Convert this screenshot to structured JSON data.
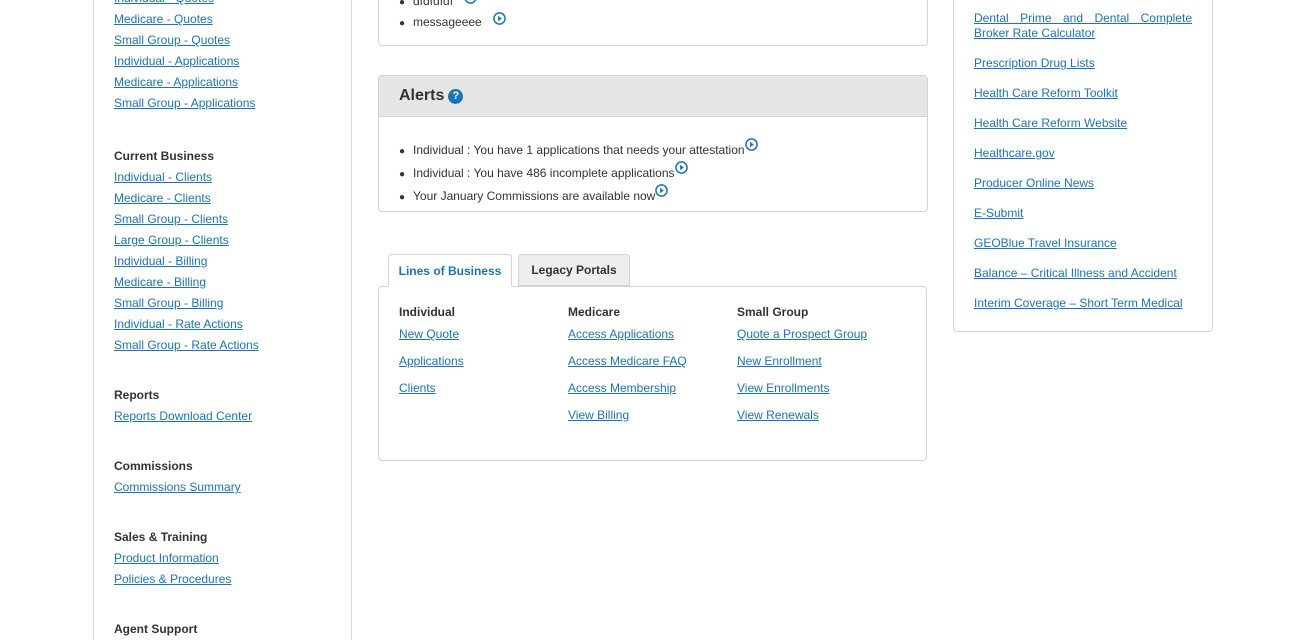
{
  "sidebar": {
    "quotes_links": [
      "Individual - Quotes",
      "Medicare - Quotes",
      "Small Group - Quotes",
      "Individual - Applications",
      "Medicare - Applications",
      "Small Group - Applications"
    ],
    "current_business": {
      "heading": "Current Business",
      "links": [
        "Individual - Clients",
        "Medicare - Clients",
        "Small Group - Clients",
        "Large Group - Clients",
        "Individual - Billing",
        "Medicare - Billing",
        "Small Group - Billing",
        "Individual - Rate Actions",
        "Small Group - Rate Actions"
      ]
    },
    "reports": {
      "heading": "Reports",
      "links": [
        "Reports Download Center"
      ]
    },
    "commissions": {
      "heading": "Commissions",
      "links": [
        "Commissions Summary"
      ]
    },
    "sales_training": {
      "heading": "Sales & Training",
      "links": [
        "Product Information",
        "Policies & Procedures"
      ]
    },
    "next_heading_partial": "Agent Support"
  },
  "messages": {
    "items": [
      "dfdfdfdf",
      "messageeee"
    ]
  },
  "alerts": {
    "title": "Alerts",
    "help_glyph": "?",
    "items": [
      "Individual : You have 1 applications that needs your attestation",
      "Individual : You have 486 incomplete applications",
      "Your January Commissions are available now"
    ]
  },
  "tabs": {
    "lines_of_business": "Lines of Business",
    "legacy_portals": "Legacy Portals",
    "active": "Lines of Business"
  },
  "lines_of_business": {
    "individual": {
      "heading": "Individual",
      "links": [
        "New Quote",
        "Applications",
        "Clients"
      ]
    },
    "medicare": {
      "heading": "Medicare",
      "links": [
        "Access Applications",
        "Access Medicare FAQ",
        "Access Membership",
        "View Billing"
      ]
    },
    "small_group": {
      "heading": "Small Group",
      "links": [
        "Quote a Prospect Group",
        "New Enrollment",
        "View Enrollments",
        "View Renewals"
      ]
    }
  },
  "resources": {
    "links": [
      "Dental Prime and Dental Complete Broker Rate Calculator",
      "Prescription Drug Lists",
      "Health Care Reform Toolkit",
      "Health Care Reform Website",
      "Healthcare.gov",
      "Producer Online News",
      "E-Submit",
      "GEOBlue Travel Insurance",
      "Balance – Critical Illness and Accident",
      "Interim Coverage – Short Term Medical"
    ]
  },
  "colors": {
    "link": "#1a75b5",
    "text": "#333333",
    "border": "#d4d4d4",
    "alerts_header_bg": "#e6e6e6"
  }
}
